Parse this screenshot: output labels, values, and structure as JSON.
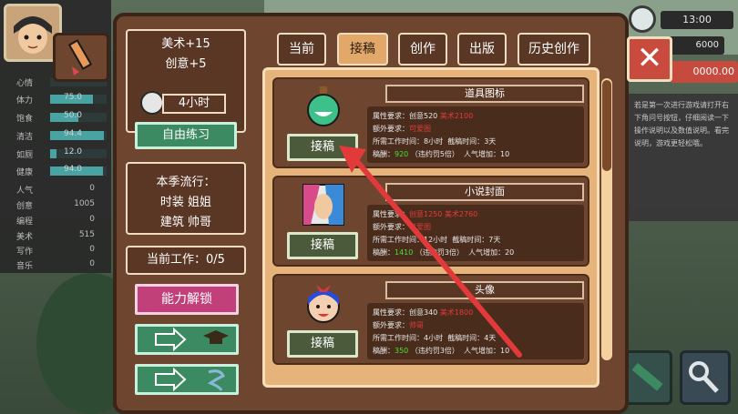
{
  "stats": [
    {
      "label": "心情",
      "value": "",
      "fill": 0.0
    },
    {
      "label": "体力",
      "value": "75.0",
      "fill": 0.75
    },
    {
      "label": "饱食",
      "value": "50.0",
      "fill": 0.5
    },
    {
      "label": "清洁",
      "value": "94.4",
      "fill": 0.944
    },
    {
      "label": "如厕",
      "value": "12.0",
      "fill": 0.12
    },
    {
      "label": "健康",
      "value": "94.0",
      "fill": 0.94
    }
  ],
  "attributes": [
    {
      "label": "人气",
      "value": "0"
    },
    {
      "label": "创意",
      "value": "1005"
    },
    {
      "label": "编程",
      "value": "0"
    },
    {
      "label": "美术",
      "value": "515"
    },
    {
      "label": "写作",
      "value": "0"
    },
    {
      "label": "音乐",
      "value": "0"
    }
  ],
  "top_right": {
    "time": "13:00",
    "money": "6000",
    "money2": "0000.00",
    "close": "✕",
    "hint": "若是第一次进行游戏请打开右下角问号按钮，仔细阅读一下操作说明以及数值说明。看完说明，游戏更轻松哦。"
  },
  "practice": {
    "bonus1": "美术+15",
    "bonus2": "创意+5",
    "time": "4小时",
    "button": "自由练习"
  },
  "trend": {
    "title": "本季流行：",
    "line1": "时装 姐姐",
    "line2": "建筑 帅哥"
  },
  "work": {
    "label": "当前工作：0/5"
  },
  "unlock_button": "能力解锁",
  "tabs": [
    {
      "label": "当前",
      "active": false
    },
    {
      "label": "接稿",
      "active": true
    },
    {
      "label": "创作",
      "active": false
    },
    {
      "label": "出版",
      "active": false
    },
    {
      "label": "历史创作",
      "active": false
    }
  ],
  "jobs": [
    {
      "name": "道具图标",
      "req_label": "属性要求：",
      "req_a": "创意520",
      "req_b": "美术2100",
      "extra_label": "额外要求：",
      "extra": "可爱图",
      "time_label": "所需工作时间：",
      "time": "8小时",
      "deadline_label": "截稿时间：",
      "deadline": "3天",
      "reward_label": "稿酬：",
      "reward": "920",
      "penalty": "（违约罚5倍）",
      "pop_label": "人气增加：",
      "pop": "10",
      "accept": "接稿"
    },
    {
      "name": "小说封面",
      "req_label": "属性要求：",
      "req_a": "创意1250",
      "req_b": "美术2760",
      "extra_label": "额外要求：",
      "extra": "可爱图",
      "time_label": "所需工作时间：",
      "time": "12小时",
      "deadline_label": "截稿时间：",
      "deadline": "7天",
      "reward_label": "稿酬：",
      "reward": "1410",
      "penalty": "（违约罚3倍）",
      "pop_label": "人气增加：",
      "pop": "20",
      "accept": "接稿"
    },
    {
      "name": "头像",
      "req_label": "属性要求：",
      "req_a": "创意340",
      "req_b": "美术1800",
      "extra_label": "额外要求：",
      "extra": "帅哥",
      "time_label": "所需工作时间：",
      "time": "4小时",
      "deadline_label": "截稿时间：",
      "deadline": "4天",
      "reward_label": "稿酬：",
      "reward": "350",
      "penalty": "（违约罚3倍）",
      "pop_label": "人气增加：",
      "pop": "10",
      "accept": "接稿"
    }
  ]
}
